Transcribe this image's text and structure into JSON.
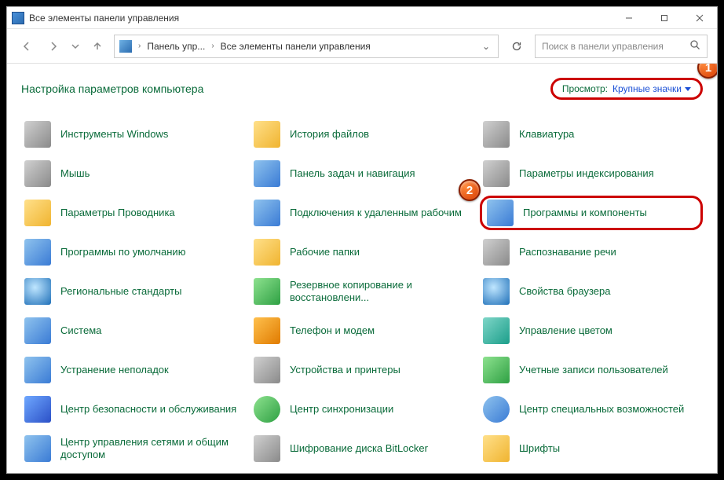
{
  "titlebar": {
    "title": "Все элементы панели управления"
  },
  "nav": {
    "crumb1": "Панель упр...",
    "crumb2": "Все элементы панели управления",
    "search_placeholder": "Поиск в панели управления"
  },
  "content": {
    "heading": "Настройка параметров компьютера",
    "view_label": "Просмотр:",
    "view_value": "Крупные значки"
  },
  "callouts": {
    "c1": "1",
    "c2": "2"
  },
  "items": {
    "i0": "Инструменты Windows",
    "i1": "История файлов",
    "i2": "Клавиатура",
    "i3": "Мышь",
    "i4": "Панель задач и навигация",
    "i5": "Параметры индексирования",
    "i6": "Параметры Проводника",
    "i7": "Подключения к удаленным рабочим",
    "i8": "Программы и компоненты",
    "i9": "Программы по умолчанию",
    "i10": "Рабочие папки",
    "i11": "Распознавание речи",
    "i12": "Региональные стандарты",
    "i13": "Резервное копирование и восстановлени...",
    "i14": "Свойства браузера",
    "i15": "Система",
    "i16": "Телефон и модем",
    "i17": "Управление цветом",
    "i18": "Устранение неполадок",
    "i19": "Устройства и принтеры",
    "i20": "Учетные записи пользователей",
    "i21": "Центр безопасности и обслуживания",
    "i22": "Центр синхронизации",
    "i23": "Центр специальных возможностей",
    "i24": "Центр управления сетями и общим доступом",
    "i25": "Шифрование диска BitLocker",
    "i26": "Шрифты"
  }
}
